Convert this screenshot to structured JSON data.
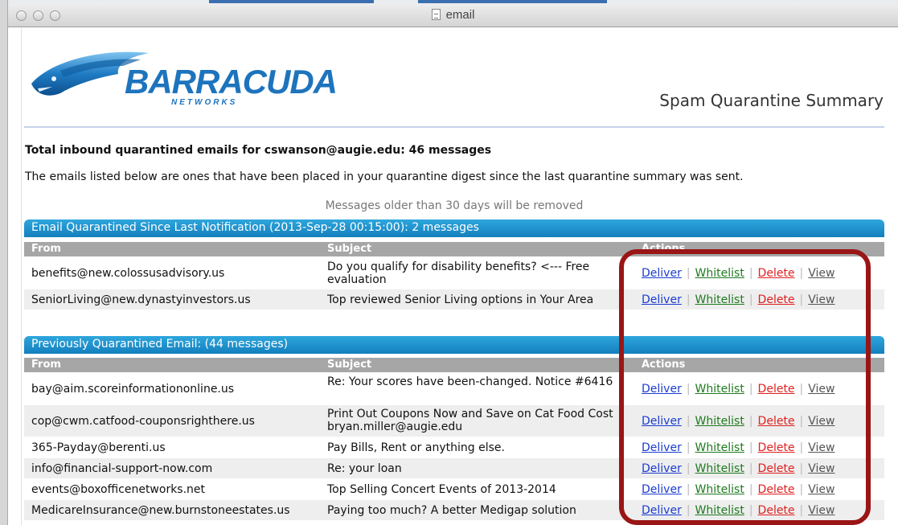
{
  "window": {
    "title": "email"
  },
  "header": {
    "logo_text": "BARRACUDA",
    "logo_sub": "NETWORKS",
    "page_title": "Spam Quarantine Summary"
  },
  "summary": {
    "total": "Total inbound quarantined emails for cswanson@augie.edu: 46 messages",
    "description": "The emails listed below are ones that have been placed in your quarantine digest since the last quarantine summary was sent.",
    "older_note": "Messages older than 30 days will be removed"
  },
  "columns": {
    "from": "From",
    "subject": "Subject",
    "actions": "Actions"
  },
  "action_labels": {
    "deliver": "Deliver",
    "whitelist": "Whitelist",
    "delete": "Delete",
    "view": "View"
  },
  "sections": [
    {
      "title": "Email Quarantined Since Last Notification (2013-Sep-28 00:15:00): 2 messages",
      "rows": [
        {
          "from": "benefits@new.colossusadvisory.us",
          "subject": "Do you qualify for disability benefits? <--- Free evaluation"
        },
        {
          "from": "SeniorLiving@new.dynastyinvestors.us",
          "subject": "Top reviewed Senior Living options in Your Area"
        }
      ]
    },
    {
      "title": "Previously Quarantined Email: (44 messages)",
      "rows": [
        {
          "from": "bay@aim.scoreinformationonline.us",
          "subject": "Re: Your scores have been-changed. Notice #6416"
        },
        {
          "from": "cop@cwm.catfood-couponsrighthere.us",
          "subject": "Print Out Coupons Now and Save on Cat Food Cost bryan.miller@augie.edu"
        },
        {
          "from": "365-Payday@berenti.us",
          "subject": "Pay Bills, Rent or anything else."
        },
        {
          "from": "info@financial-support-now.com",
          "subject": "Re: your loan"
        },
        {
          "from": "events@boxofficenetworks.net",
          "subject": "Top Selling Concert Events of 2013-2014"
        },
        {
          "from": "MedicareInsurance@new.burnstoneestates.us",
          "subject": "Paying too much? A better Medigap solution"
        }
      ]
    }
  ],
  "colors": {
    "accent": "#1a8fcf",
    "highlight": "#9a1515"
  }
}
